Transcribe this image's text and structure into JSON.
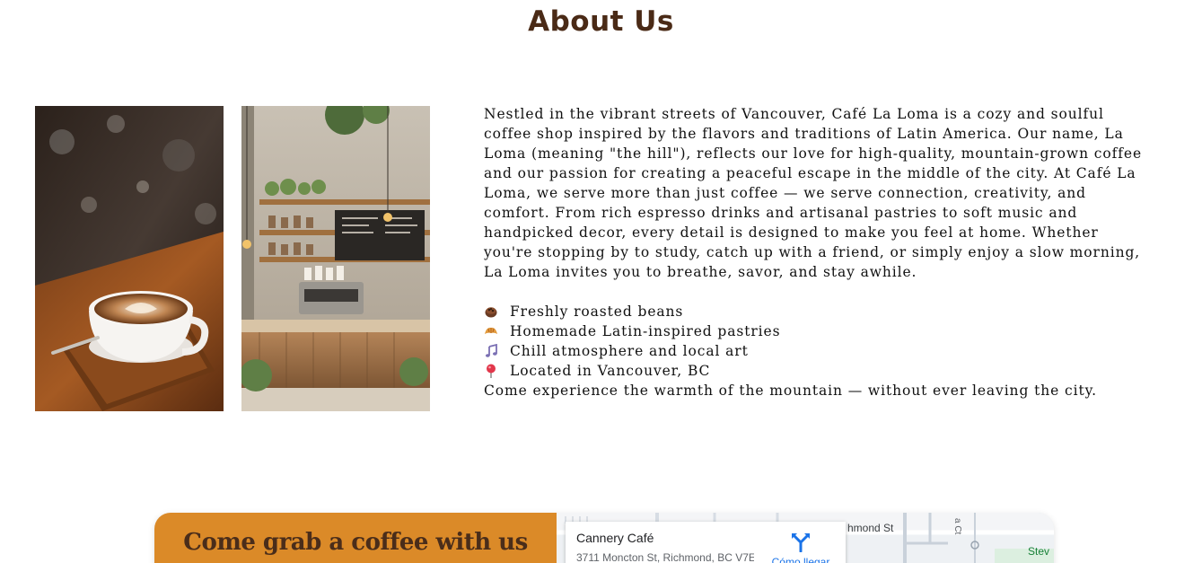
{
  "about": {
    "title": "About Us",
    "paragraph": "Nestled in the vibrant streets of Vancouver, Café La Loma is a cozy and soulful coffee shop inspired by the flavors and traditions of Latin America. Our name, La Loma (meaning \"the hill\"), reflects our love for high-quality, mountain-grown coffee and our passion for creating a peaceful escape in the middle of the city. At Café La Loma, we serve more than just coffee — we serve connection, creativity, and comfort. From rich espresso drinks and artisanal pastries to soft music and handpicked decor, every detail is designed to make you feel at home. Whether you're stopping by to study, catch up with a friend, or simply enjoy a slow morning, La Loma invites you to breathe, savor, and stay awhile.",
    "features": [
      {
        "icon": "coffee-beans-icon",
        "text": "Freshly roasted beans"
      },
      {
        "icon": "croissant-icon",
        "text": "Homemade Latin-inspired pastries"
      },
      {
        "icon": "music-notes-icon",
        "text": "Chill atmosphere and local art"
      },
      {
        "icon": "pin-icon",
        "text": "Located in Vancouver, BC"
      }
    ],
    "closing": "Come experience the warmth of the mountain — without ever leaving the city."
  },
  "visit": {
    "heading": "Come grab a coffee with us",
    "map": {
      "place_name": "Cannery Café",
      "address": "3711 Moncton St, Richmond, BC V7E",
      "directions_label": "Cómo llegar",
      "street_label": "hmond St",
      "poi_label": "Stev",
      "court_label": "a Ct"
    }
  },
  "colors": {
    "title": "#4a2a16",
    "cta_background": "#db8a28",
    "cta_text": "#4a2d1a",
    "link_blue": "#1a73e8"
  }
}
